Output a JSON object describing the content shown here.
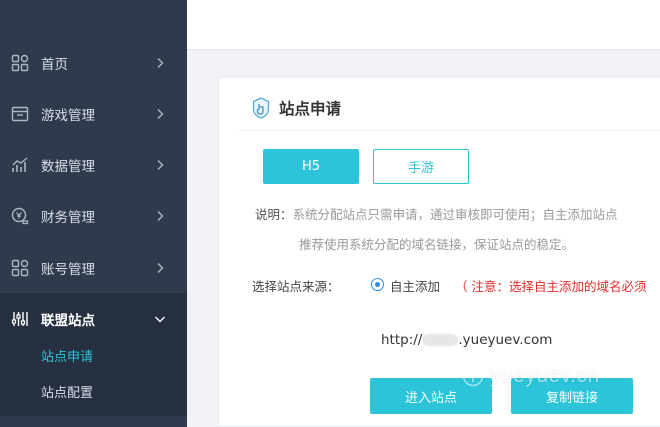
{
  "sidebar": {
    "items": [
      {
        "label": "首页",
        "icon": "grid-icon"
      },
      {
        "label": "游戏管理",
        "icon": "window-icon"
      },
      {
        "label": "数据管理",
        "icon": "bar-chart-icon"
      },
      {
        "label": "财务管理",
        "icon": "finance-icon"
      },
      {
        "label": "账号管理",
        "icon": "grid-icon"
      },
      {
        "label": "联盟站点",
        "icon": "sliders-icon",
        "expanded": true
      }
    ],
    "submenu": [
      {
        "label": "站点申请",
        "current": true
      },
      {
        "label": "站点配置"
      }
    ]
  },
  "card": {
    "title": "站点申请",
    "tabs": [
      {
        "label": "H5",
        "active": true
      },
      {
        "label": "手游",
        "active": false
      }
    ],
    "desc_lead": "说明：",
    "desc_line1": "系统分配站点只需申请，通过审核即可使用；自主添加站点",
    "desc_line2": "推荐使用系统分配的域名链接，保证站点的稳定。",
    "source_label": "选择站点来源：",
    "radio_label": "自主添加",
    "notice": "（ 注意：选择自主添加的域名必须",
    "url_prefix": "http://",
    "url_suffix": ".yueyuev.com",
    "enter_button": "进入站点",
    "copy_button": "复制链接"
  },
  "watermark": {
    "text": "yueyuev.cn"
  },
  "colors": {
    "sidebar_bg": "#2f3a4c",
    "sidebar_active_bg": "#263040",
    "accent": "#2bc4d8",
    "notice": "#e52d2d",
    "radio": "#2d8cf0"
  }
}
